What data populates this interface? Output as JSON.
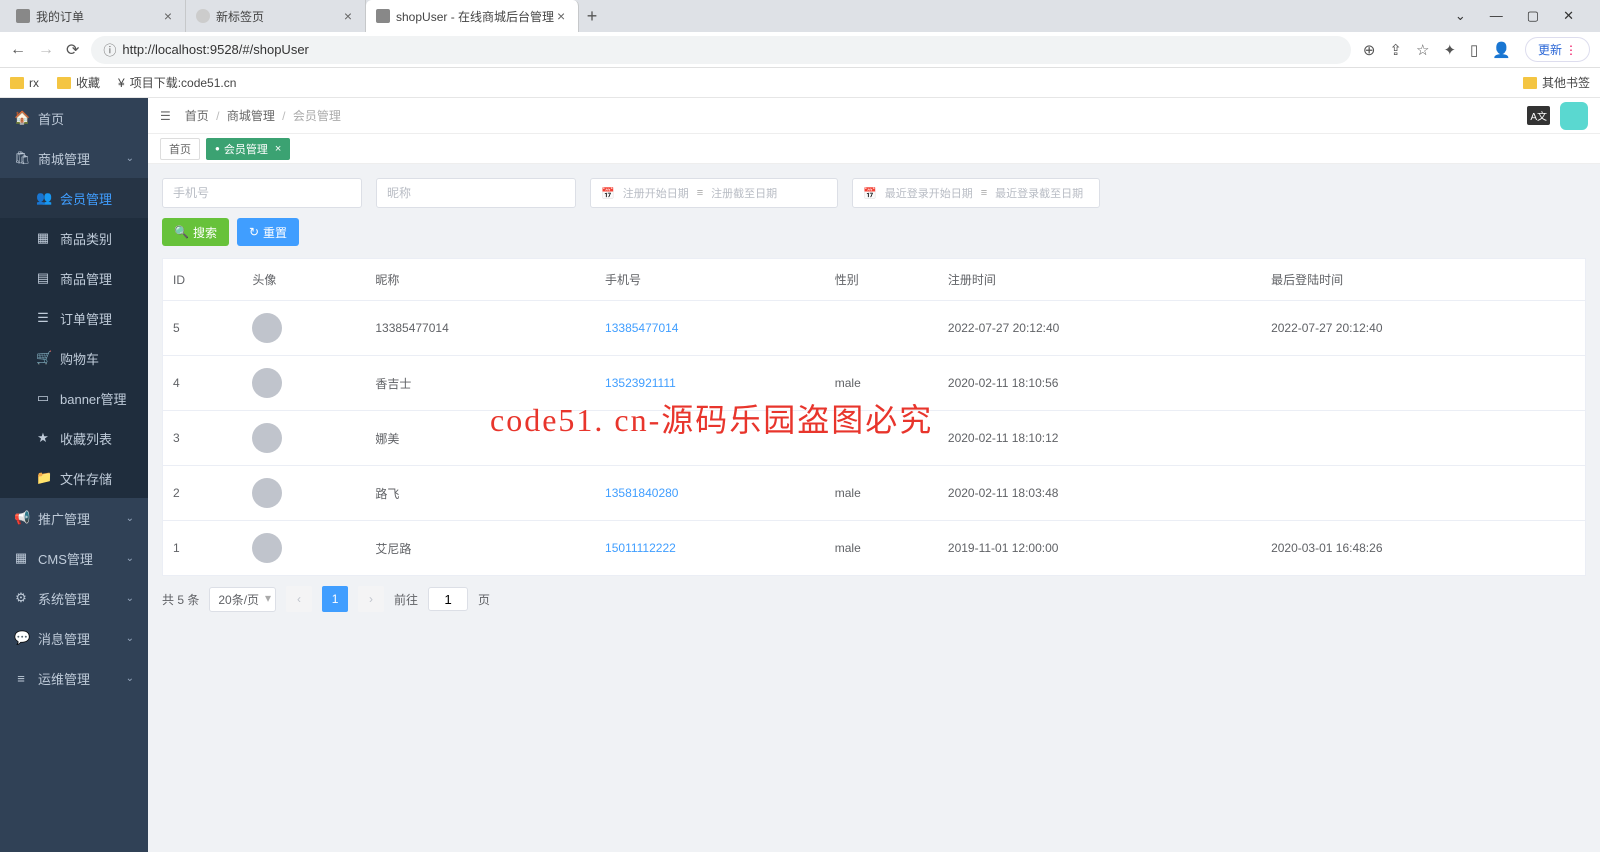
{
  "browser": {
    "tabs": [
      {
        "title": "我的订单"
      },
      {
        "title": "新标签页"
      },
      {
        "title": "shopUser - 在线商城后台管理"
      }
    ],
    "url": "http://localhost:9528/#/shopUser",
    "update_btn": "更新",
    "bookmarks": [
      {
        "label": "rx"
      },
      {
        "label": "收藏"
      },
      {
        "label": "项目下载:code51.cn"
      }
    ],
    "other_bookmarks": "其他书签"
  },
  "sidebar": {
    "items": [
      {
        "icon": "🏠",
        "label": "首页"
      },
      {
        "icon": "🛍",
        "label": "商城管理",
        "expand": true
      },
      {
        "label": "会员管理",
        "sub": true,
        "active": true,
        "icon": "👥"
      },
      {
        "label": "商品类别",
        "sub": true,
        "icon": "▦"
      },
      {
        "label": "商品管理",
        "sub": true,
        "icon": "▤"
      },
      {
        "label": "订单管理",
        "sub": true,
        "icon": "☰"
      },
      {
        "label": "购物车",
        "sub": true,
        "icon": "🛒"
      },
      {
        "label": "banner管理",
        "sub": true,
        "icon": "▭"
      },
      {
        "label": "收藏列表",
        "sub": true,
        "icon": "★"
      },
      {
        "label": "文件存储",
        "sub": true,
        "icon": "📁"
      },
      {
        "icon": "📢",
        "label": "推广管理",
        "expand": true
      },
      {
        "icon": "▦",
        "label": "CMS管理",
        "expand": true
      },
      {
        "icon": "⚙",
        "label": "系统管理",
        "expand": true
      },
      {
        "icon": "💬",
        "label": "消息管理",
        "expand": true
      },
      {
        "icon": "≡",
        "label": "运维管理",
        "expand": true
      }
    ]
  },
  "breadcrumb": {
    "home": "首页",
    "parent": "商城管理",
    "current": "会员管理"
  },
  "page_tabs": {
    "home": "首页",
    "active": "会员管理"
  },
  "filters": {
    "phone_ph": "手机号",
    "nick_ph": "昵称",
    "reg_start": "注册开始日期",
    "reg_end": "注册截至日期",
    "login_start": "最近登录开始日期",
    "login_end": "最近登录截至日期",
    "search_btn": "搜索",
    "reset_btn": "重置"
  },
  "table": {
    "headers": {
      "id": "ID",
      "avatar": "头像",
      "nick": "昵称",
      "phone": "手机号",
      "gender": "性别",
      "reg": "注册时间",
      "last": "最后登陆时间"
    },
    "rows": [
      {
        "id": "5",
        "nick": "13385477014",
        "phone": "13385477014",
        "gender": "",
        "reg": "2022-07-27 20:12:40",
        "last": "2022-07-27 20:12:40"
      },
      {
        "id": "4",
        "nick": "香吉士",
        "phone": "13523921111",
        "gender": "male",
        "reg": "2020-02-11 18:10:56",
        "last": ""
      },
      {
        "id": "3",
        "nick": "娜美",
        "phone": "",
        "gender": "",
        "reg": "2020-02-11 18:10:12",
        "last": ""
      },
      {
        "id": "2",
        "nick": "路飞",
        "phone": "13581840280",
        "gender": "male",
        "reg": "2020-02-11 18:03:48",
        "last": ""
      },
      {
        "id": "1",
        "nick": "艾尼路",
        "phone": "15011112222",
        "gender": "male",
        "reg": "2019-11-01 12:00:00",
        "last": "2020-03-01 16:48:26"
      }
    ]
  },
  "pager": {
    "total": "共 5 条",
    "per_page": "20条/页",
    "current": "1",
    "goto_label": "前往",
    "goto_val": "1",
    "page_suffix": "页"
  },
  "watermark": "code51. cn-源码乐园盗图必究"
}
